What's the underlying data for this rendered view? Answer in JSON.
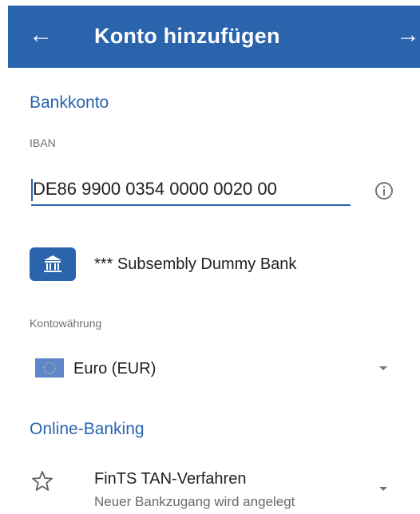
{
  "appbar": {
    "back_icon": "arrow-left-icon",
    "title": "Konto hinzufügen",
    "next_icon": "arrow-right-icon",
    "color": "#2a64ad"
  },
  "bankaccount": {
    "section_title": "Bankkonto",
    "iban_label": "IBAN",
    "iban_value": "DE86 9900 0354 0000 0020 00",
    "info_icon": "info-circle-icon",
    "bank_icon": "bank-building-icon",
    "bank_name": "*** Subsembly Dummy Bank"
  },
  "currency": {
    "label": "Kontowährung",
    "flag_icon": "eu-flag-icon",
    "selected": "Euro (EUR)",
    "dropdown_icon": "dropdown-arrow-icon"
  },
  "online_banking": {
    "section_title": "Online-Banking",
    "star_icon": "star-outline-icon",
    "title": "FinTS TAN-Verfahren",
    "subtitle": "Neuer Bankzugang wird angelegt",
    "dropdown_icon": "dropdown-arrow-icon"
  }
}
